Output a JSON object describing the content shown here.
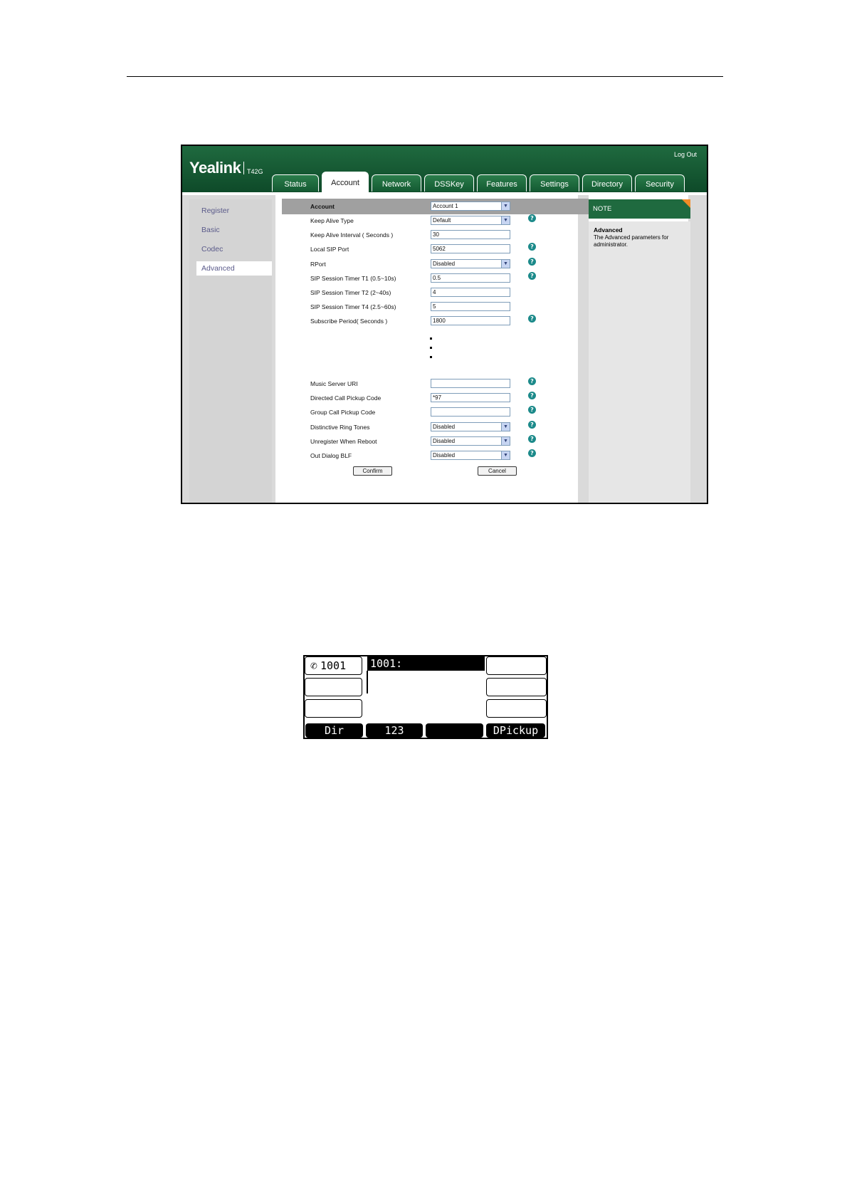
{
  "header": {
    "brand": "Yealink",
    "model": "T42G",
    "logout": "Log Out",
    "tabs": [
      "Status",
      "Account",
      "Network",
      "DSSKey",
      "Features",
      "Settings",
      "Directory",
      "Security"
    ],
    "active_tab": "Account"
  },
  "sidebar": {
    "items": [
      "Register",
      "Basic",
      "Codec",
      "Advanced"
    ],
    "active": "Advanced"
  },
  "form": {
    "account_label": "Account",
    "account_value": "Account 1",
    "rows_top": [
      {
        "label": "Keep Alive Type",
        "value": "Default",
        "type": "select",
        "help": true
      },
      {
        "label": "Keep Alive Interval ( Seconds )",
        "value": "30",
        "type": "text",
        "help": false
      },
      {
        "label": "Local SIP Port",
        "value": "5062",
        "type": "text",
        "help": true
      },
      {
        "label": "RPort",
        "value": "Disabled",
        "type": "select",
        "help": true
      },
      {
        "label": "SIP Session Timer T1 (0.5~10s)",
        "value": "0.5",
        "type": "text",
        "help": true
      },
      {
        "label": "SIP Session Timer T2 (2~40s)",
        "value": "4",
        "type": "text",
        "help": false
      },
      {
        "label": "SIP Session Timer T4 (2.5~60s)",
        "value": "5",
        "type": "text",
        "help": false
      },
      {
        "label": "Subscribe Period( Seconds )",
        "value": "1800",
        "type": "text",
        "help": true
      }
    ],
    "rows_bottom": [
      {
        "label": "Music Server URI",
        "value": "",
        "type": "text",
        "help": true
      },
      {
        "label": "Directed Call Pickup Code",
        "value": "*97",
        "type": "text",
        "help": true
      },
      {
        "label": "Group Call Pickup Code",
        "value": "",
        "type": "text",
        "help": true
      },
      {
        "label": "Distinctive Ring Tones",
        "value": "Disabled",
        "type": "select",
        "help": true
      },
      {
        "label": "Unregister When Reboot",
        "value": "Disabled",
        "type": "select",
        "help": true
      },
      {
        "label": "Out Dialog BLF",
        "value": "Disabled",
        "type": "select",
        "help": true
      }
    ],
    "confirm": "Confirm",
    "cancel": "Cancel"
  },
  "note": {
    "header": "NOTE",
    "title": "Advanced",
    "text": "The Advanced parameters for administrator."
  },
  "phone": {
    "line": "1001",
    "title": "1001:",
    "softkeys": [
      "Dir",
      "123",
      "",
      "DPickup"
    ]
  },
  "colors": {
    "banner": "#1f6a3f",
    "note_corner": "#f28c28",
    "help_icon": "#1c8a8a"
  }
}
